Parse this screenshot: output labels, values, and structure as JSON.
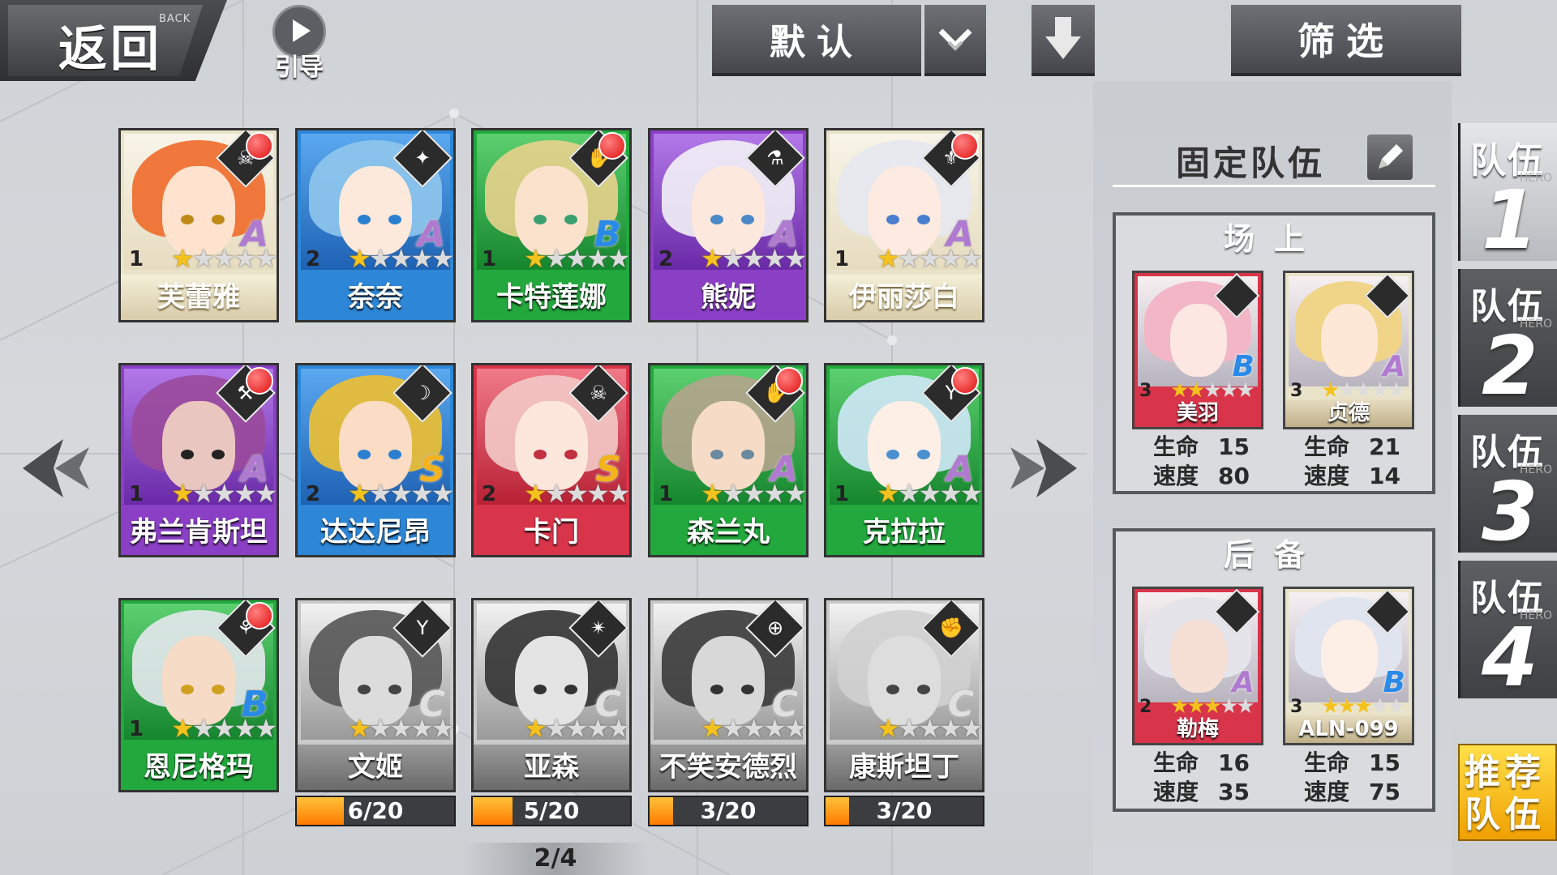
{
  "top_bar": {
    "back_label": "返回",
    "back_sub": "BACK",
    "guide_label": "引导",
    "sort_label": "默认",
    "filter_label": "筛选"
  },
  "hero_cards": [
    {
      "level": "1",
      "stars": 1,
      "rank": "A",
      "name": "芙蕾雅",
      "frame": "#e9e3c9",
      "tone": "light",
      "hair": "#ef6a2a",
      "skin": "#ffe3cf",
      "eye": "#c08a18",
      "cls_icon": "☠",
      "notify": true
    },
    {
      "level": "2",
      "stars": 1,
      "rank": "A",
      "name": "奈奈",
      "frame": "#2d86d6",
      "tone": "blue",
      "hair": "#8fc6ec",
      "skin": "#fde9dc",
      "eye": "#2a7fd0",
      "cls_icon": "✦",
      "notify": false
    },
    {
      "level": "1",
      "stars": 1,
      "rank": "B",
      "name": "卡特莲娜",
      "frame": "#22a83d",
      "tone": "green",
      "hair": "#e8d28c",
      "skin": "#fbe2cc",
      "eye": "#3aa070",
      "cls_icon": "✋",
      "notify": true
    },
    {
      "level": "2",
      "stars": 1,
      "rank": "A",
      "name": "熊妮",
      "frame": "#8a3fc4",
      "tone": "purple",
      "hair": "#f2f2f6",
      "skin": "#fde8dd",
      "eye": "#4a88c8",
      "cls_icon": "⚗",
      "notify": false
    },
    {
      "level": "1",
      "stars": 1,
      "rank": "A",
      "name": "伊丽莎白",
      "frame": "#e9e3c9",
      "tone": "light",
      "hair": "#e6e8f0",
      "skin": "#fdeae0",
      "eye": "#4a7fd0",
      "cls_icon": "⚜",
      "notify": true
    },
    {
      "level": "1",
      "stars": 1,
      "rank": "A",
      "name": "弗兰肯斯坦",
      "frame": "#8a3fc4",
      "tone": "purple",
      "hair": "#9a4a9c",
      "skin": "#e9c6c0",
      "eye": "#222222",
      "cls_icon": "⚒",
      "notify": true
    },
    {
      "level": "2",
      "stars": 1,
      "rank": "S",
      "name": "达达尼昂",
      "frame": "#2d86d6",
      "tone": "blue",
      "hair": "#f0c030",
      "skin": "#fbdcc4",
      "eye": "#2a7fd0",
      "cls_icon": "☽",
      "notify": false
    },
    {
      "level": "2",
      "stars": 1,
      "rank": "S",
      "name": "卡门",
      "frame": "#d8344a",
      "tone": "red",
      "hair": "#f3c9c6",
      "skin": "#fde7dc",
      "eye": "#c03040",
      "cls_icon": "☠",
      "notify": false
    },
    {
      "level": "1",
      "stars": 1,
      "rank": "A",
      "name": "森兰丸",
      "frame": "#22a83d",
      "tone": "green",
      "hair": "#b4a48c",
      "skin": "#f6dcc6",
      "eye": "#6a8aa0",
      "cls_icon": "✋",
      "notify": true
    },
    {
      "level": "1",
      "stars": 1,
      "rank": "A",
      "name": "克拉拉",
      "frame": "#22a83d",
      "tone": "green",
      "hair": "#cfe8f8",
      "skin": "#fdeee6",
      "eye": "#4a90d0",
      "cls_icon": "Y",
      "notify": true
    },
    {
      "level": "1",
      "stars": 1,
      "rank": "B",
      "name": "恩尼格玛",
      "frame": "#22a83d",
      "tone": "green",
      "hair": "#e6e8ee",
      "skin": "#f6dcc6",
      "eye": "#d0a020",
      "cls_icon": "⚘",
      "notify": true
    },
    {
      "level": "",
      "stars": 1,
      "rank": "C",
      "name": "文姬",
      "frame": "#c9c9c9",
      "tone": "gray",
      "hair": "#555555",
      "skin": "#dcdcdc",
      "eye": "#444444",
      "cls_icon": "Y",
      "notify": false
    },
    {
      "level": "",
      "stars": 1,
      "rank": "C",
      "name": "亚森",
      "frame": "#c9c9c9",
      "tone": "gray",
      "hair": "#333333",
      "skin": "#e4e4e4",
      "eye": "#333333",
      "cls_icon": "✴",
      "notify": false
    },
    {
      "level": "",
      "stars": 1,
      "rank": "C",
      "name": "不笑安德烈",
      "frame": "#c9c9c9",
      "tone": "gray",
      "hair": "#3a3a3a",
      "skin": "#d8d8d8",
      "eye": "#333333",
      "cls_icon": "⊕",
      "notify": false
    },
    {
      "level": "",
      "stars": 1,
      "rank": "C",
      "name": "康斯坦丁",
      "frame": "#c9c9c9",
      "tone": "gray",
      "hair": "#d0d0d0",
      "skin": "#dddddd",
      "eye": "#444444",
      "cls_icon": "✊",
      "notify": false
    }
  ],
  "fragments": [
    {
      "text": "6/20",
      "fraction": 0.3
    },
    {
      "text": "5/20",
      "fraction": 0.25
    },
    {
      "text": "3/20",
      "fraction": 0.15
    },
    {
      "text": "3/20",
      "fraction": 0.15
    }
  ],
  "page_indicator": "2/4",
  "panel": {
    "title": "固定队伍",
    "onfield_header": "场上",
    "reserve_header": "后备",
    "hp_label": "生命",
    "speed_label": "速度",
    "onfield": [
      {
        "level": "3",
        "stars": 2,
        "rank": "B",
        "name": "美羽",
        "frame": "#d8344a",
        "hair": "#f2b6c6",
        "skin": "#fde7e2",
        "hp": "15",
        "speed": "80"
      },
      {
        "level": "3",
        "stars": 1,
        "rank": "A",
        "name": "贞德",
        "frame": "#e9e3c9",
        "hair": "#f0d488",
        "skin": "#fde7d6",
        "hp": "21",
        "speed": "14"
      }
    ],
    "reserve": [
      {
        "level": "2",
        "stars": 3,
        "rank": "A",
        "name": "勒梅",
        "frame": "#d8344a",
        "hair": "#e4e4ea",
        "skin": "#f6e0d6",
        "hp": "16",
        "speed": "35"
      },
      {
        "level": "3",
        "stars": 3,
        "rank": "B",
        "name": "ALN-099",
        "frame": "#e9e3c9",
        "hair": "#dfe4ee",
        "skin": "#fdeee6",
        "hp": "15",
        "speed": "75"
      }
    ]
  },
  "team_tabs": [
    {
      "label": "队伍",
      "num": "1",
      "sub": "HERO",
      "active": true
    },
    {
      "label": "队伍",
      "num": "2",
      "sub": "HERO",
      "active": false
    },
    {
      "label": "队伍",
      "num": "3",
      "sub": "HERO",
      "active": false
    },
    {
      "label": "队伍",
      "num": "4",
      "sub": "HERO",
      "active": false
    }
  ],
  "recommend_label": "推荐队伍",
  "colors": {
    "accent_gold": "#f4c21d",
    "notify_red": "#e01010",
    "recommend_yellow": "#f0a000"
  }
}
